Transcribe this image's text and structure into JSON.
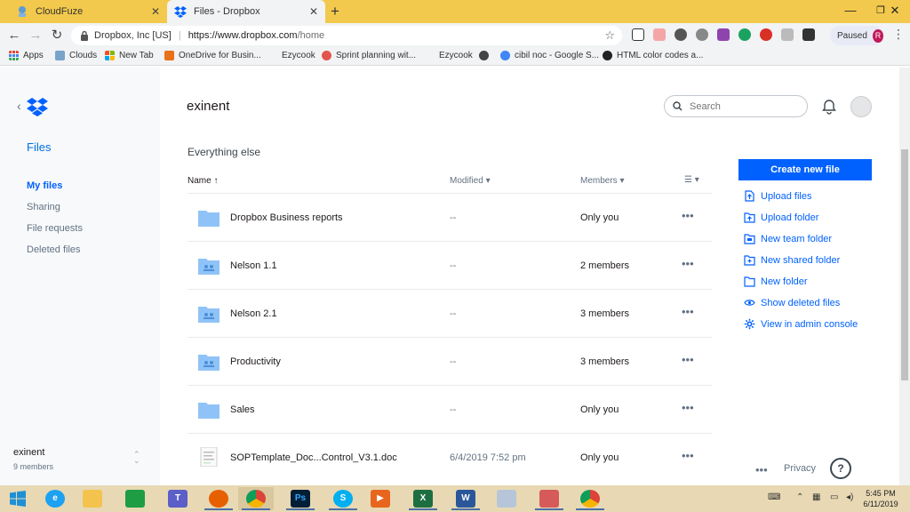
{
  "browser": {
    "tabs": [
      {
        "title": "CloudFuze",
        "active": false
      },
      {
        "title": "Files - Dropbox",
        "active": true
      }
    ],
    "new_tab_symbol": "+",
    "address": {
      "org": "Dropbox, Inc [US]",
      "url_host": "https://www.dropbox.com",
      "url_path": "/home"
    },
    "profile": {
      "status": "Paused",
      "initial": "R"
    },
    "bookmarks": [
      {
        "label": "Apps",
        "color": "#e94235"
      },
      {
        "label": "Clouds",
        "color": "#7aa3c9"
      },
      {
        "label": "New Tab",
        "color": "#f4b400"
      },
      {
        "label": "OneDrive for Busin...",
        "color": "#e8711a"
      },
      {
        "label": "Ezycook",
        "color": ""
      },
      {
        "label": "Sprint planning wit...",
        "color": "#e2564d"
      },
      {
        "label": "Ezycook",
        "color": ""
      },
      {
        "label": "",
        "color": "#444444"
      },
      {
        "label": "cibil noc - Google S...",
        "color": "#4285f4"
      },
      {
        "label": "HTML color codes a...",
        "color": "#222222"
      }
    ]
  },
  "dropbox": {
    "sidebar": {
      "section": "Files",
      "items": [
        {
          "label": "My files",
          "active": true
        },
        {
          "label": "Sharing",
          "active": false
        },
        {
          "label": "File requests",
          "active": false
        },
        {
          "label": "Deleted files",
          "active": false
        }
      ],
      "team": {
        "name": "exinent",
        "members": "9 members"
      }
    },
    "header": {
      "breadcrumb": "exinent",
      "search_placeholder": "Search"
    },
    "section_title": "Everything else",
    "columns": {
      "name": "Name",
      "modified": "Modified",
      "members": "Members"
    },
    "files": [
      {
        "name": "Dropbox Business reports",
        "modified": "--",
        "members": "Only you",
        "type": "folder"
      },
      {
        "name": "Nelson 1.1",
        "modified": "--",
        "members": "2 members",
        "type": "shared-folder"
      },
      {
        "name": "Nelson 2.1",
        "modified": "--",
        "members": "3 members",
        "type": "shared-folder"
      },
      {
        "name": "Productivity",
        "modified": "--",
        "members": "3 members",
        "type": "shared-folder"
      },
      {
        "name": "Sales",
        "modified": "--",
        "members": "Only you",
        "type": "folder"
      },
      {
        "name": "SOPTemplate_Doc...Control_V3.1.doc",
        "modified": "6/4/2019 7:52 pm",
        "members": "Only you",
        "type": "doc"
      }
    ],
    "primary_action": "Create new file",
    "actions": [
      {
        "label": "Upload files",
        "icon": "upload-file-icon"
      },
      {
        "label": "Upload folder",
        "icon": "upload-folder-icon"
      },
      {
        "label": "New team folder",
        "icon": "team-folder-icon"
      },
      {
        "label": "New shared folder",
        "icon": "shared-folder-icon"
      },
      {
        "label": "New folder",
        "icon": "folder-icon"
      },
      {
        "label": "Show deleted files",
        "icon": "eye-icon"
      },
      {
        "label": "View in admin console",
        "icon": "gear-icon"
      }
    ],
    "footer": {
      "privacy": "Privacy",
      "help": "?"
    }
  },
  "taskbar": {
    "clock_time": "5:45 PM",
    "clock_date": "6/11/2019"
  },
  "colors": {
    "accent": "#0061fe",
    "tabstrip": "#f2c94c",
    "folder": "#8fc3f7"
  }
}
